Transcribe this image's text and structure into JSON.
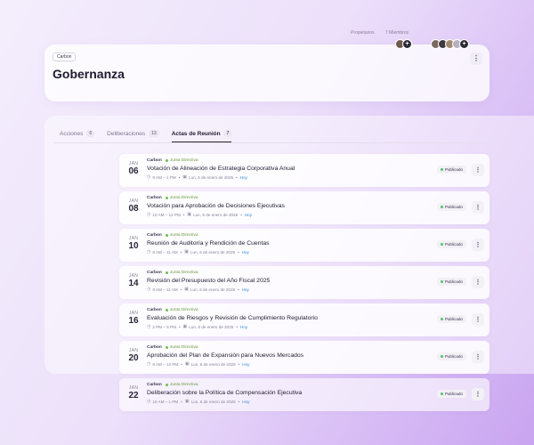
{
  "header": {
    "org_chip": "Carbon",
    "title": "Gobernanza",
    "owners_label": "Propietarios",
    "members_label": "7 Miembros",
    "more_icon": "⋮",
    "add_icon": "+"
  },
  "tabs": [
    {
      "label": "Acciones",
      "count": "6",
      "active": false
    },
    {
      "label": "Deliberaciones",
      "count": "13",
      "active": false
    },
    {
      "label": "Actas de Reunión",
      "count": "7",
      "active": true
    }
  ],
  "meetings": [
    {
      "month": "JAN",
      "day": "06",
      "org": "Carbon",
      "board": "Junta Directiva",
      "title": "Votación de Alineación de Estrategia Corporativa Anual",
      "time": "9 AM – 1 PM",
      "date": "Lun, 6 de enero de 2025",
      "today": "Hoy",
      "status": "Publicado"
    },
    {
      "month": "JAN",
      "day": "08",
      "org": "Carbon",
      "board": "Junta Directiva",
      "title": "Votación para Aprobación de Decisiones Ejecutivas",
      "time": "10 AM – 12 PM",
      "date": "Lun, 6 de enero de 2025",
      "today": "Hoy",
      "status": "Publicado"
    },
    {
      "month": "JAN",
      "day": "10",
      "org": "Carbon",
      "board": "Junta Directiva",
      "title": "Reunión de Auditoría y Rendición de Cuentas",
      "time": "8 AM – 11 AM",
      "date": "Lun, 6 de enero de 2025",
      "today": "Hoy",
      "status": "Publicado"
    },
    {
      "month": "JAN",
      "day": "14",
      "org": "Carbon",
      "board": "Junta Directiva",
      "title": "Revisión del Presupuesto del Año Fiscal 2025",
      "time": "9 AM – 11 AM",
      "date": "Lun, 6 de enero de 2025",
      "today": "Hoy",
      "status": "Publicado"
    },
    {
      "month": "JAN",
      "day": "16",
      "org": "Carbon",
      "board": "Junta Directiva",
      "title": "Evaluación de Riesgos y Revisión de Cumplimiento Regulatorio",
      "time": "2 PM – 5 PM",
      "date": "Lun, 6 de enero de 2025",
      "today": "Hoy",
      "status": "Publicado"
    },
    {
      "month": "JAN",
      "day": "20",
      "org": "Carbon",
      "board": "Junta Directiva",
      "title": "Aprobación del Plan de Expansión para Nuevos Mercados",
      "time": "9 AM – 12 PM",
      "date": "Lun, 6 de enero de 2025",
      "today": "Hoy",
      "status": "Publicado"
    },
    {
      "month": "JAN",
      "day": "22",
      "org": "Carbon",
      "board": "Junta Directiva",
      "title": "Deliberación sobre la Política de Compensación Ejecutiva",
      "time": "10 AM – 1 PM",
      "date": "Lun, 6 de enero de 2025",
      "today": "Hoy",
      "status": "Publicado"
    }
  ]
}
